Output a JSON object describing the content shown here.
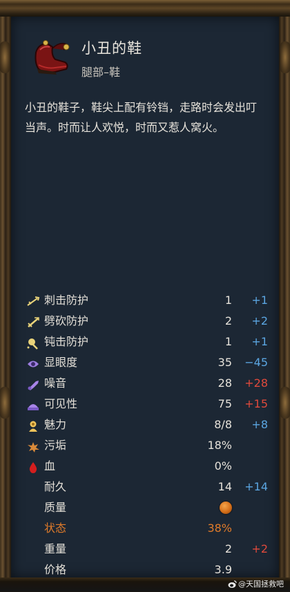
{
  "item": {
    "icon": "jester-shoe-icon",
    "name": "小丑的鞋",
    "slot": "腿部–鞋",
    "description": "小丑的鞋子，鞋尖上配有铃铛，走路时会发出叮当声。时而让人欢悦，时而又惹人窝火。"
  },
  "stats": [
    {
      "icon": "stab-protection-icon",
      "label": "刺击防护",
      "value": "1",
      "mod": "+1",
      "mod_color": "blue"
    },
    {
      "icon": "slash-protection-icon",
      "label": "劈砍防护",
      "value": "2",
      "mod": "+2",
      "mod_color": "blue"
    },
    {
      "icon": "blunt-protection-icon",
      "label": "钝击防护",
      "value": "1",
      "mod": "+1",
      "mod_color": "blue"
    },
    {
      "icon": "conspicuousness-icon",
      "label": "显眼度",
      "value": "35",
      "mod": "−45",
      "mod_color": "blue"
    },
    {
      "icon": "noise-icon",
      "label": "噪音",
      "value": "28",
      "mod": "+28",
      "mod_color": "red"
    },
    {
      "icon": "visibility-icon",
      "label": "可见性",
      "value": "75",
      "mod": "+15",
      "mod_color": "red"
    },
    {
      "icon": "charisma-icon",
      "label": "魅力",
      "value": "8/8",
      "mod": "+8",
      "mod_color": "blue"
    },
    {
      "icon": "dirt-icon",
      "label": "污垢",
      "value": "18%",
      "mod": "",
      "mod_color": ""
    },
    {
      "icon": "blood-icon",
      "label": "血",
      "value": "0%",
      "mod": "",
      "mod_color": ""
    },
    {
      "icon": "",
      "label": "耐久",
      "value": "14",
      "mod": "+14",
      "mod_color": "blue"
    },
    {
      "icon": "",
      "label": "质量",
      "value": "",
      "mod": "",
      "mod_color": ""
    },
    {
      "icon": "",
      "label": "状态",
      "value": "38%",
      "mod": "",
      "mod_color": ""
    },
    {
      "icon": "",
      "label": "重量",
      "value": "2",
      "mod": "+2",
      "mod_color": "red"
    },
    {
      "icon": "",
      "label": "价格",
      "value": "3.9",
      "mod": "",
      "mod_color": ""
    }
  ],
  "quality_icon": "quality-coin-icon",
  "colors": {
    "positive": "#5ba6e2",
    "negative": "#e04a3c",
    "status": "#e07b2a"
  },
  "watermark": {
    "icon": "weibo-icon",
    "text": "@天国拯救吧"
  }
}
